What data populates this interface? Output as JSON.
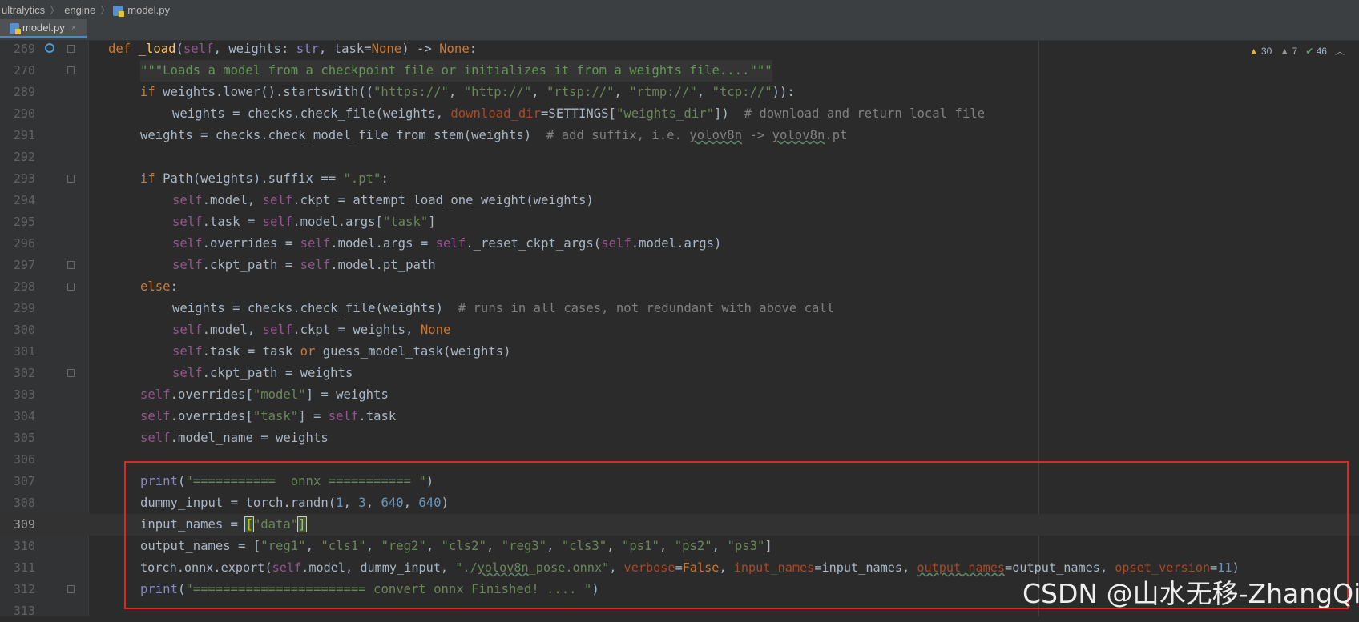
{
  "breadcrumb": {
    "items": [
      "ultralytics",
      "engine",
      "model.py"
    ]
  },
  "tab": {
    "label": "model.py",
    "close": "×"
  },
  "inspections": {
    "warnings": "30",
    "weak_warnings": "7",
    "ok": "46"
  },
  "watermark": "CSDN @山水无移-ZhangQian",
  "colors": {
    "editor_bg": "#2b2b2b",
    "keyword": "#cc7832",
    "string": "#6a8759",
    "highlight_box": "#e0261f"
  },
  "lines": [
    {
      "n": "269",
      "code": "def _load(self, weights: str, task=None) -> None:"
    },
    {
      "n": "270",
      "code": "\"\"\"Loads a model from a checkpoint file or initializes it from a weights file....\"\"\""
    },
    {
      "n": "289",
      "code": "if weights.lower().startswith((\"https://\", \"http://\", \"rtsp://\", \"rtmp://\", \"tcp://\")):"
    },
    {
      "n": "290",
      "code": "weights = checks.check_file(weights, download_dir=SETTINGS[\"weights_dir\"])  # download and return local file"
    },
    {
      "n": "291",
      "code": "weights = checks.check_model_file_from_stem(weights)  # add suffix, i.e. yolov8n -> yolov8n.pt"
    },
    {
      "n": "292",
      "code": ""
    },
    {
      "n": "293",
      "code": "if Path(weights).suffix == \".pt\":"
    },
    {
      "n": "294",
      "code": "self.model, self.ckpt = attempt_load_one_weight(weights)"
    },
    {
      "n": "295",
      "code": "self.task = self.model.args[\"task\"]"
    },
    {
      "n": "296",
      "code": "self.overrides = self.model.args = self._reset_ckpt_args(self.model.args)"
    },
    {
      "n": "297",
      "code": "self.ckpt_path = self.model.pt_path"
    },
    {
      "n": "298",
      "code": "else:"
    },
    {
      "n": "299",
      "code": "weights = checks.check_file(weights)  # runs in all cases, not redundant with above call"
    },
    {
      "n": "300",
      "code": "self.model, self.ckpt = weights, None"
    },
    {
      "n": "301",
      "code": "self.task = task or guess_model_task(weights)"
    },
    {
      "n": "302",
      "code": "self.ckpt_path = weights"
    },
    {
      "n": "303",
      "code": "self.overrides[\"model\"] = weights"
    },
    {
      "n": "304",
      "code": "self.overrides[\"task\"] = self.task"
    },
    {
      "n": "305",
      "code": "self.model_name = weights"
    },
    {
      "n": "306",
      "code": ""
    },
    {
      "n": "307",
      "code": "print(\"===========  onnx =========== \")"
    },
    {
      "n": "308",
      "code": "dummy_input = torch.randn(1, 3, 640, 640)"
    },
    {
      "n": "309",
      "code": "input_names = [\"data\"]"
    },
    {
      "n": "310",
      "code": "output_names = [\"reg1\", \"cls1\", \"reg2\", \"cls2\", \"reg3\", \"cls3\", \"ps1\", \"ps2\", \"ps3\"]"
    },
    {
      "n": "311",
      "code": "torch.onnx.export(self.model, dummy_input, \"./yolov8n_pose.onnx\", verbose=False, input_names=input_names, output_names=output_names, opset_version=11)"
    },
    {
      "n": "312",
      "code": "print(\"======================= convert onnx Finished! .... \")"
    },
    {
      "n": "313",
      "code": ""
    }
  ]
}
